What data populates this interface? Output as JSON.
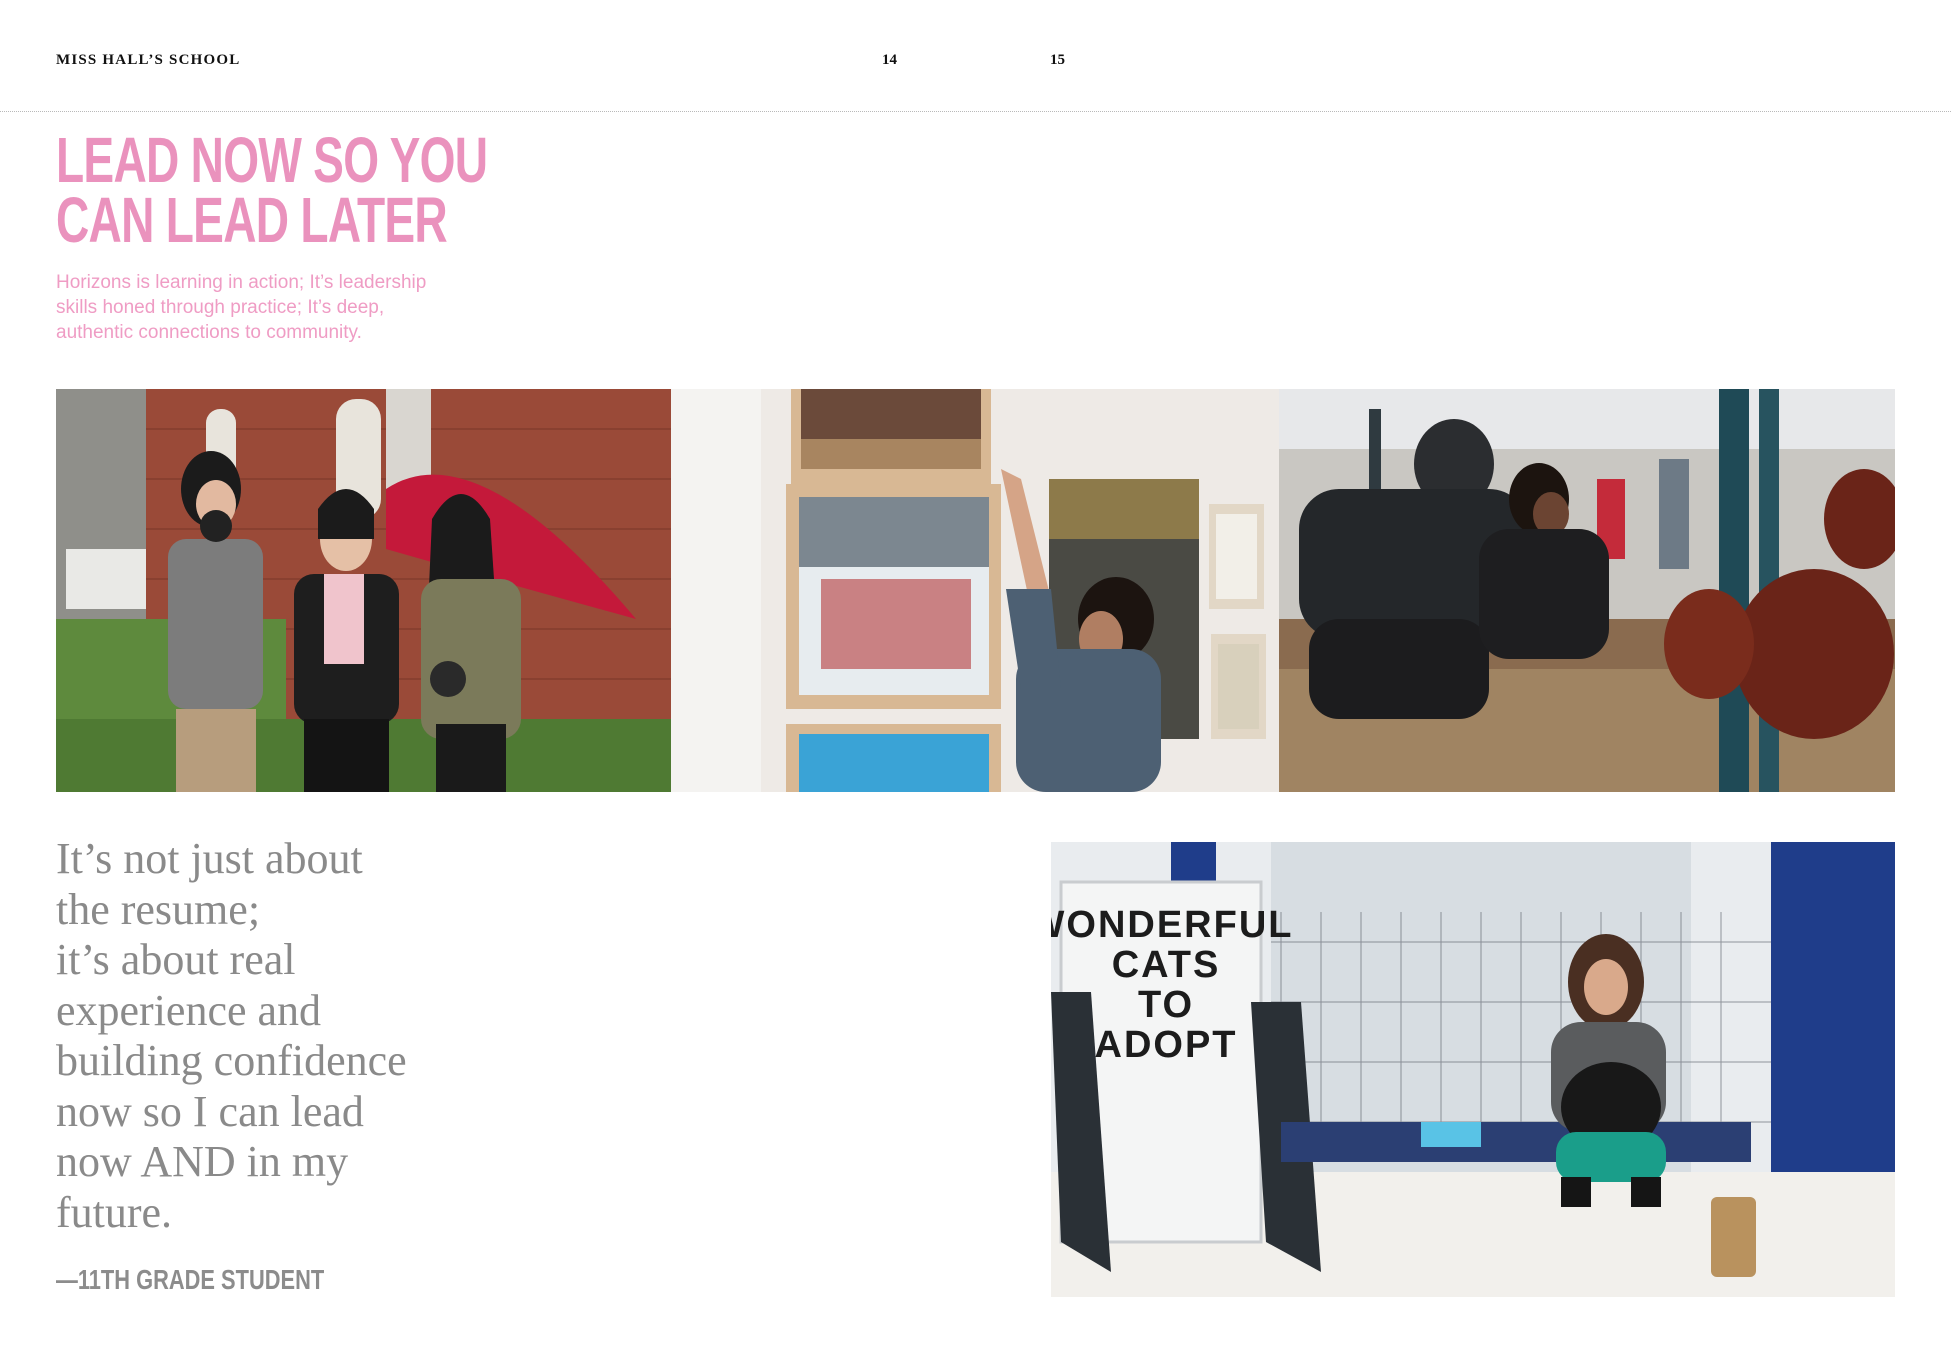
{
  "header": {
    "school": "MISS HALL’S SCHOOL",
    "page_left": "14",
    "page_right": "15"
  },
  "headline": {
    "line1": "LEAD NOW SO YOU",
    "line2": "CAN LEAD LATER"
  },
  "intro": {
    "line1": "Horizons is learning in action; It’s leadership",
    "line2": "skills honed through practice; It’s deep,",
    "line3": "authentic connections to community."
  },
  "quote": {
    "lines": [
      "It’s not just about",
      "the resume;",
      "it’s about real",
      "experience and",
      "building confidence",
      "now so I can lead",
      "now AND in my",
      "future."
    ],
    "attribution": "—11TH GRADE STUDENT"
  },
  "shelter_sign": {
    "line1": "WONDERFUL",
    "line2": "CATS",
    "line3": "TO",
    "line4": "ADOPT"
  },
  "colors": {
    "accent_pink": "#ea92bd",
    "quote_gray": "#8a8a8a"
  }
}
